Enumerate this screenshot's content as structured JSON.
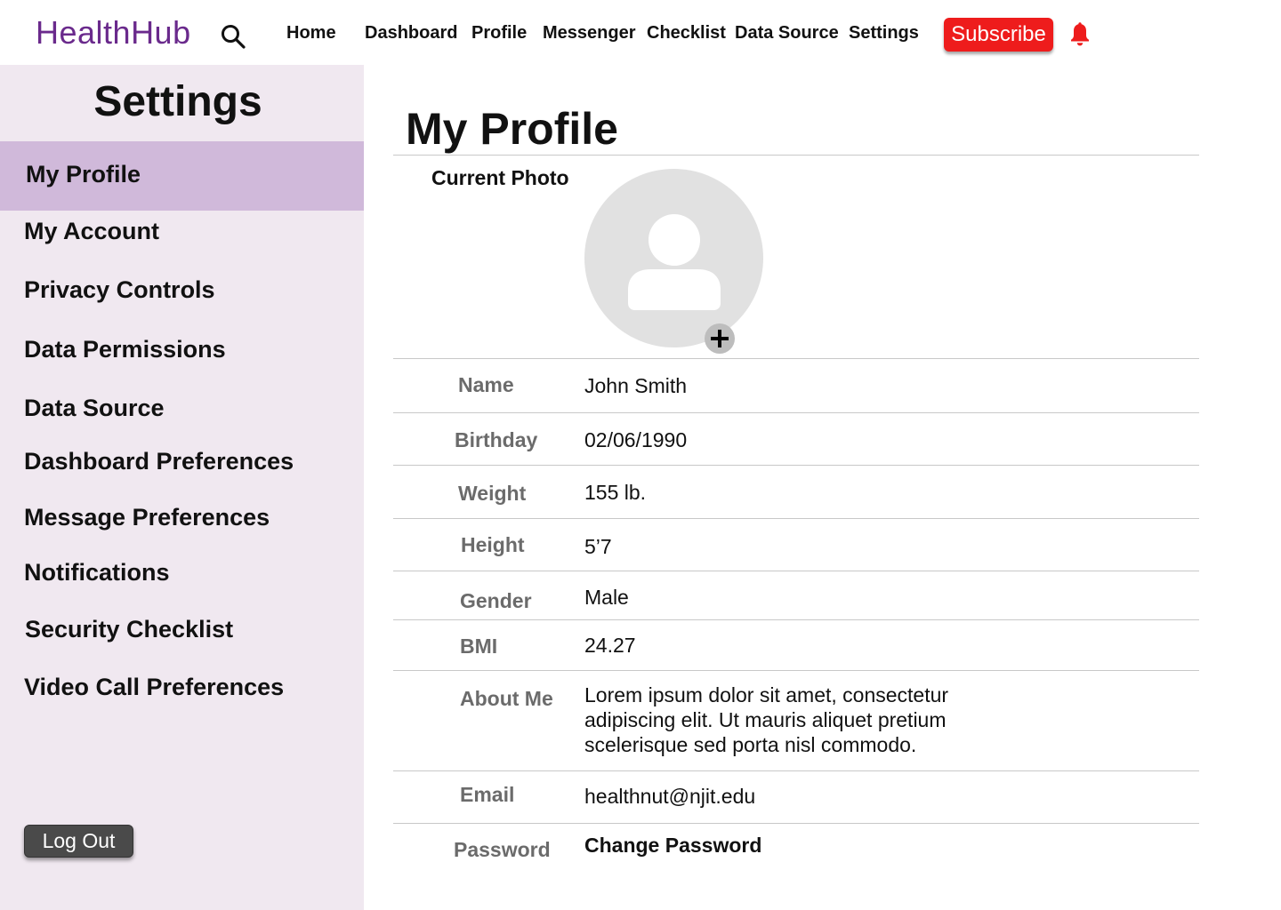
{
  "app": {
    "logo": "HealthHub"
  },
  "nav": {
    "items": [
      "Home",
      "Dashboard",
      "Profile",
      "Messenger",
      "Checklist",
      "Data Source",
      "Settings"
    ],
    "subscribe_label": "Subscribe"
  },
  "icons": {
    "search": "search-icon",
    "bell": "bell-icon",
    "add": "plus-icon",
    "avatar": "user-icon"
  },
  "colors": {
    "brand": "#6a2a8c",
    "subscribe": "#ee1c1c",
    "bell": "#ee1c1c",
    "sidebar_bg": "#f0e8f0",
    "sidebar_active": "#d0b9da",
    "logout_bg": "#4a4a4a"
  },
  "sidebar": {
    "title": "Settings",
    "items": [
      "My Profile",
      "My Account",
      "Privacy Controls",
      "Data Permissions",
      "Data Source",
      "Dashboard Preferences",
      "Message Preferences",
      "Notifications",
      "Security Checklist",
      "Video Call Preferences"
    ],
    "active": "My Profile",
    "logout_label": "Log Out"
  },
  "main": {
    "title": "My Profile",
    "photo_label": "Current Photo",
    "fields": [
      {
        "label": "Name",
        "value": "John Smith"
      },
      {
        "label": "Birthday",
        "value": "02/06/1990"
      },
      {
        "label": "Weight",
        "value": "155 lb."
      },
      {
        "label": "Height",
        "value": "5’7"
      },
      {
        "label": "Gender",
        "value": "Male"
      },
      {
        "label": "BMI",
        "value": "24.27"
      },
      {
        "label": "About Me",
        "value": "Lorem ipsum dolor sit amet, consectetur adipiscing elit. Ut mauris aliquet pretium scelerisque sed porta nisl commodo."
      },
      {
        "label": "Email",
        "value": "healthnut@njit.edu"
      },
      {
        "label": "Password",
        "value": "Change Password"
      }
    ]
  }
}
